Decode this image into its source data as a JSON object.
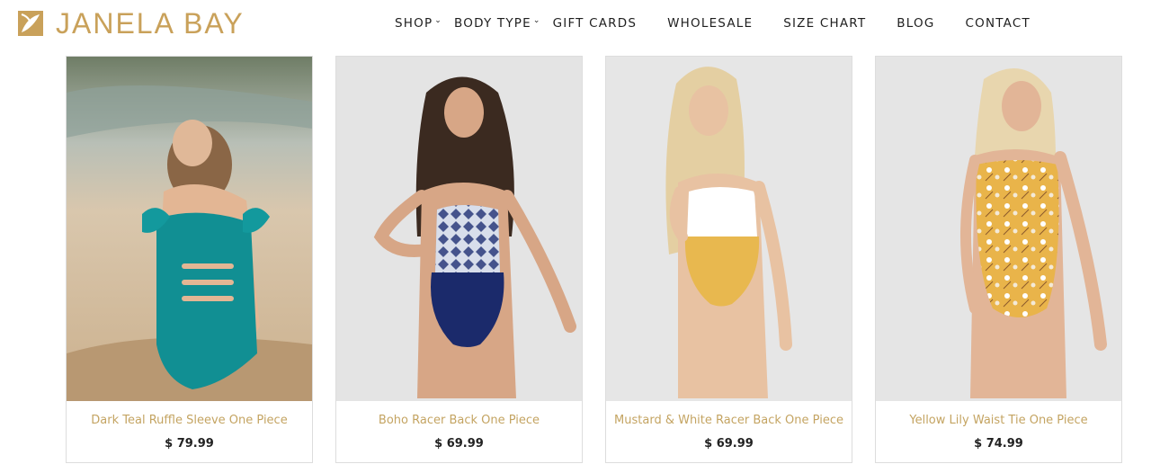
{
  "brand": {
    "name": "JANELA BAY",
    "logo_icon": "leaf-square-icon",
    "color": "#c9a15a"
  },
  "nav": {
    "items": [
      {
        "label": "SHOP",
        "has_dropdown": true,
        "dropdown_icon": "chevron-down-icon"
      },
      {
        "label": "BODY TYPE",
        "has_dropdown": true,
        "dropdown_icon": "chevron-down-icon"
      },
      {
        "label": "GIFT CARDS"
      },
      {
        "label": "WHOLESALE"
      },
      {
        "label": "SIZE CHART"
      },
      {
        "label": "BLOG"
      },
      {
        "label": "CONTACT"
      }
    ]
  },
  "products": [
    {
      "title": "Dark Teal Ruffle Sleeve One Piece",
      "price": "$ 79.99",
      "swimsuit_color": "#118f93",
      "image_icon": "product-photo"
    },
    {
      "title": "Boho Racer Back One Piece",
      "price": "$ 69.99",
      "swimsuit_color": "#1b2a6b",
      "image_icon": "product-photo"
    },
    {
      "title": "Mustard & White Racer Back One Piece",
      "price": "$ 69.99",
      "swimsuit_color": "#e8b84f",
      "image_icon": "product-photo"
    },
    {
      "title": "Yellow Lily Waist Tie One Piece",
      "price": "$ 74.99",
      "swimsuit_color": "#e9b44a",
      "image_icon": "product-photo"
    }
  ],
  "colors": {
    "title_gold": "#c4a462",
    "price": "#222222",
    "border": "#dddddd"
  }
}
